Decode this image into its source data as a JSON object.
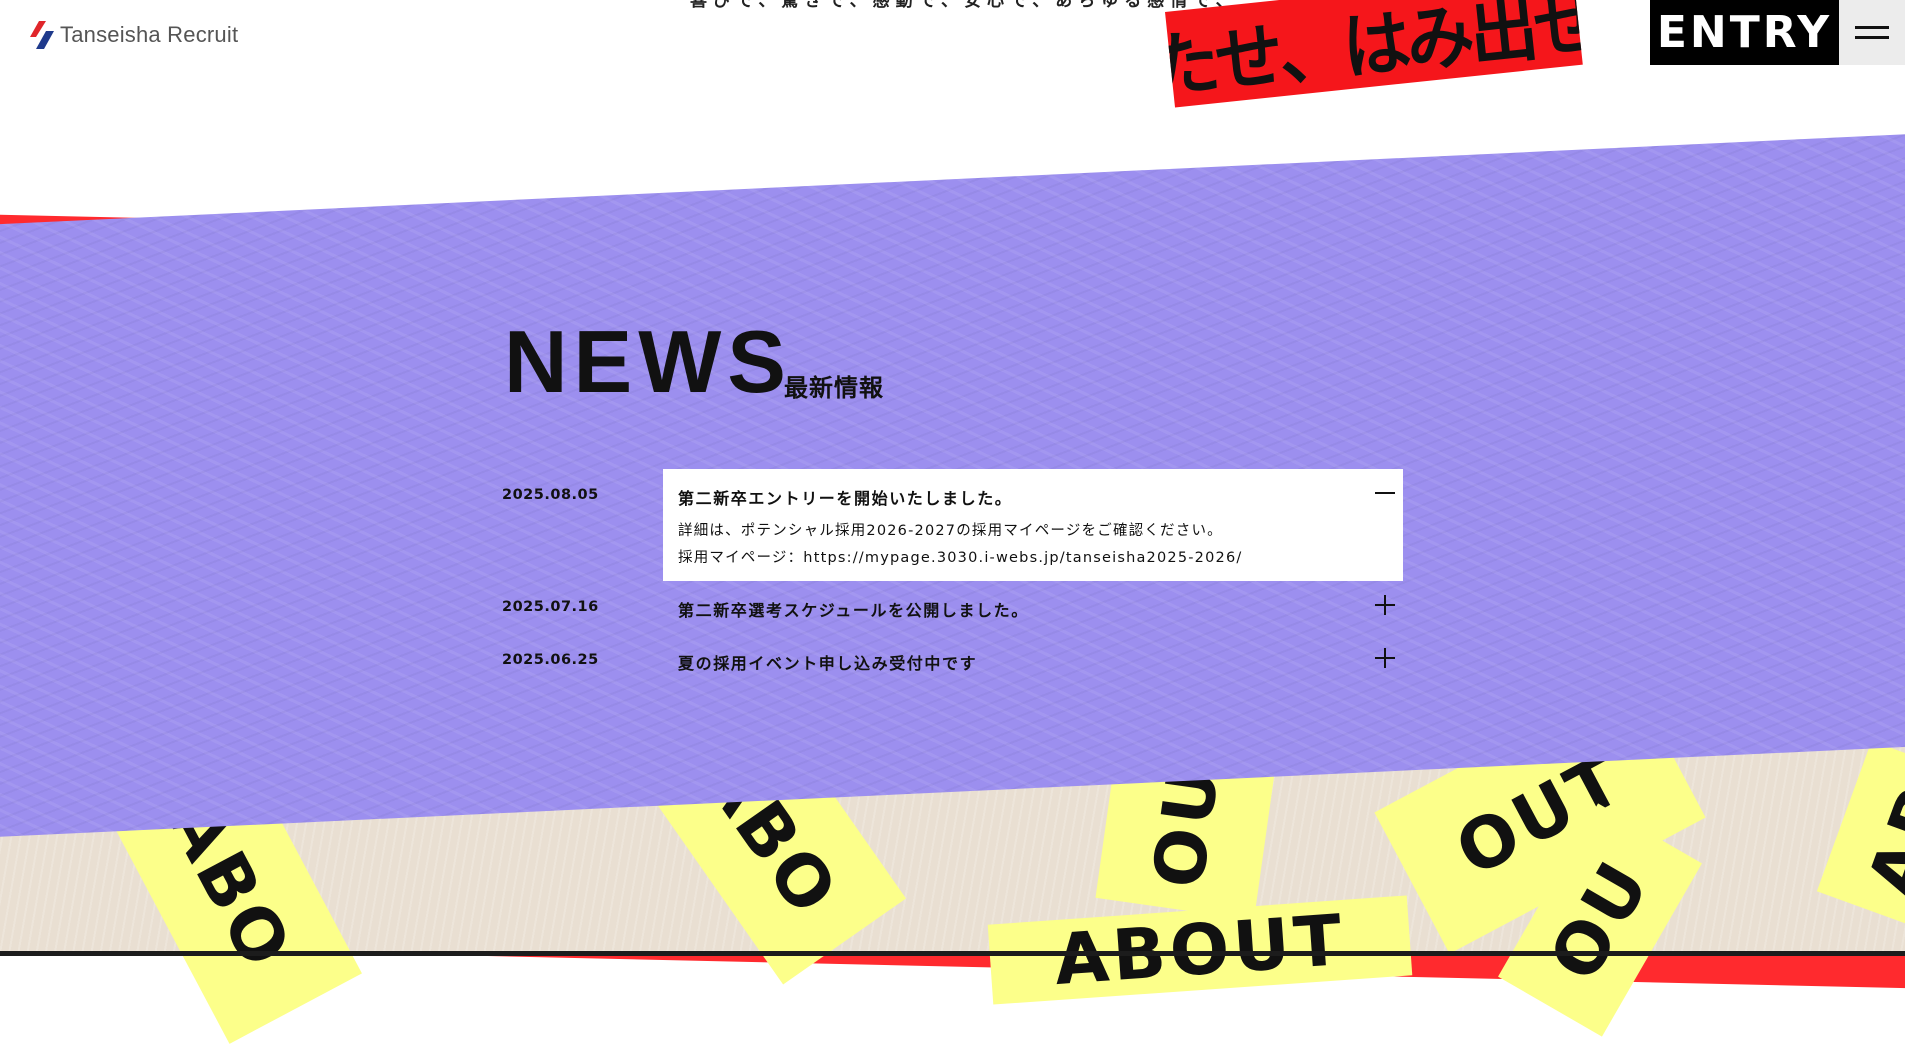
{
  "header": {
    "logo_text": "Tanseisha Recruit",
    "catch_line": "喜びで、驚きで、感動で、安心で、あらゆる感情で、",
    "catch_copy": "満たせ、はみ出せ。",
    "entry_label": "ENTRY",
    "menu_icon": "hamburger-menu-icon"
  },
  "decor": {
    "about_word": "ABOUT",
    "about_tags": [
      "ABO",
      "ABO",
      "OUT",
      "OUT",
      "UT",
      "AB",
      "OU"
    ]
  },
  "news": {
    "title": "NEWS",
    "subtitle": "最新情報",
    "items": [
      {
        "date": "2025.08.05",
        "title": "第二新卒エントリーを開始いたしました。",
        "expanded": true,
        "body": [
          "詳細は、ポテンシャル採用2026-2027の採用マイページをご確認ください。",
          "採用マイページ：https://mypage.3030.i-webs.jp/tanseisha2025-2026/"
        ],
        "toggle_icon": "minus-icon"
      },
      {
        "date": "2025.07.16",
        "title": "第二新卒選考スケジュールを公開しました。",
        "expanded": false,
        "toggle_icon": "plus-icon"
      },
      {
        "date": "2025.06.25",
        "title": "夏の採用イベント申し込み受付中です",
        "expanded": false,
        "toggle_icon": "plus-icon"
      }
    ]
  },
  "colors": {
    "red": "#ff2a2e",
    "purple": "#9c8fef",
    "yellow": "#fcff8a",
    "beige": "#e9dfd2",
    "entry_bg": "#000000"
  }
}
